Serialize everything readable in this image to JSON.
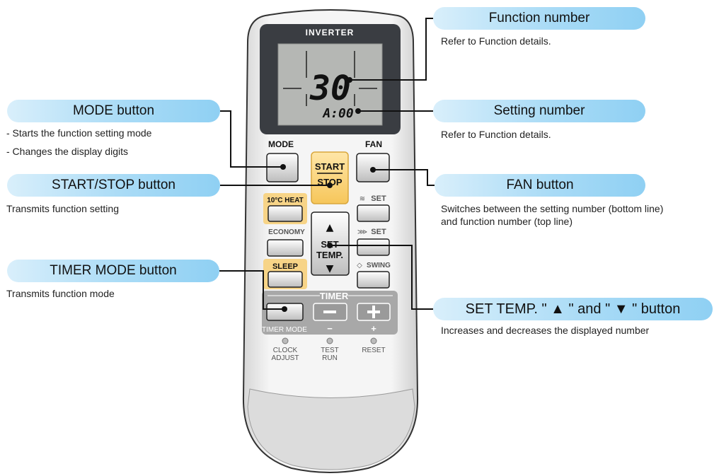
{
  "remote": {
    "brand": "INVERTER",
    "display": {
      "function_number": "30",
      "setting_number": "A:00"
    },
    "buttons": {
      "mode": "MODE",
      "fan": "FAN",
      "start": "START",
      "stop": "STOP",
      "heat": "10°C HEAT",
      "set_vertical": "SET",
      "economy": "ECONOMY",
      "set_horizontal": "SET",
      "set_temp_line1": "SET",
      "set_temp_line2": "TEMP.",
      "sleep": "SLEEP",
      "swing": "SWING",
      "timer": "TIMER",
      "timer_mode": "TIMER MODE",
      "minus": "−",
      "plus": "+"
    },
    "small_buttons": {
      "clock_line1": "CLOCK",
      "clock_line2": "ADJUST",
      "test_line1": "TEST",
      "test_line2": "RUN",
      "reset": "RESET"
    }
  },
  "callouts": {
    "function_number": {
      "title": "Function number",
      "desc": "Refer to Function details."
    },
    "setting_number": {
      "title": "Setting number",
      "desc": "Refer to Function details."
    },
    "mode_button": {
      "title": "MODE button",
      "desc1": "- Starts the function setting mode",
      "desc2": "- Changes the display digits"
    },
    "start_stop_button": {
      "title": "START/STOP button",
      "desc": "Transmits function setting"
    },
    "fan_button": {
      "title": "FAN button",
      "desc1": "Switches between the setting number (bottom line)",
      "desc2": "and function number (top line)"
    },
    "timer_mode_button": {
      "title": "TIMER MODE button",
      "desc": "Transmits function mode"
    },
    "set_temp_button": {
      "title": "SET TEMP. \" ▲ \" and \" ▼ \" button",
      "desc": "Increases and decreases the displayed number"
    }
  }
}
